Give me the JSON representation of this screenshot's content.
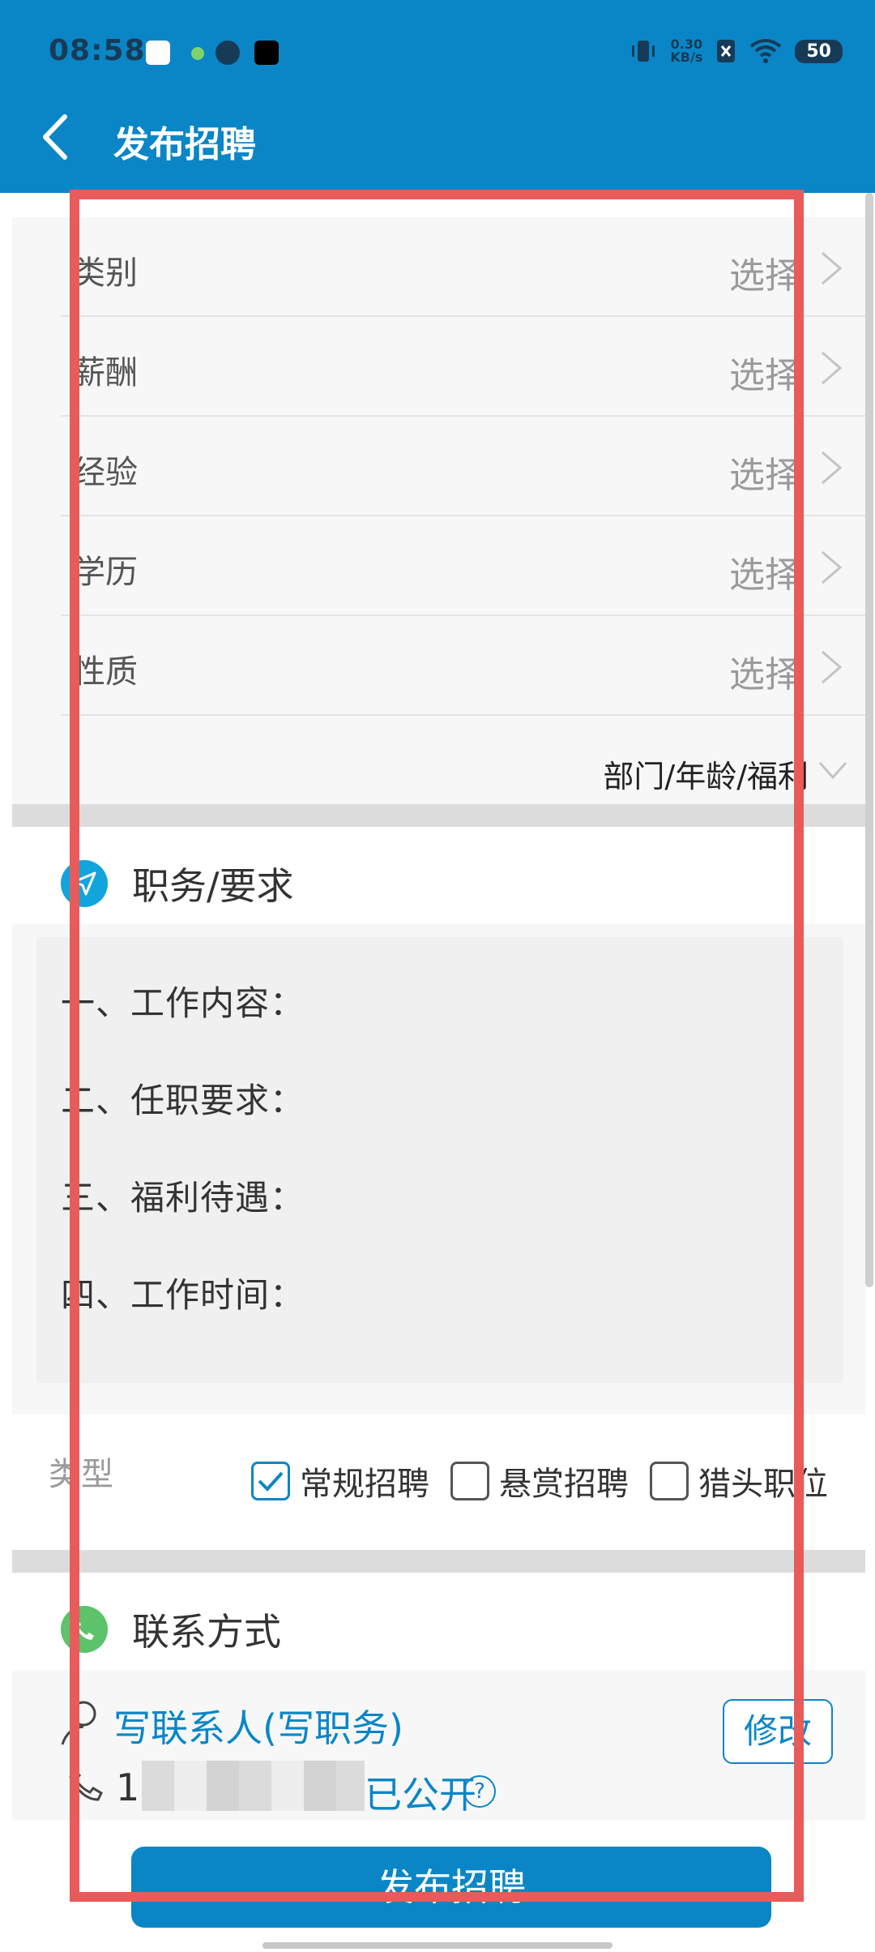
{
  "status_bar": {
    "time": "08:58",
    "net_speed_value": "0.30",
    "net_speed_unit": "KB/s",
    "battery": "50"
  },
  "header": {
    "title": "发布招聘"
  },
  "form": {
    "rows": [
      {
        "label": "类别",
        "value": "选择"
      },
      {
        "label": "薪酬",
        "value": "选择"
      },
      {
        "label": "经验",
        "value": "选择"
      },
      {
        "label": "学历",
        "value": "选择"
      },
      {
        "label": "性质",
        "value": "选择"
      }
    ],
    "more_label": "部门/年龄/福利"
  },
  "requirements": {
    "section_title": "职务/要求",
    "lines": [
      "一、工作内容：",
      "二、任职要求：",
      "三、福利待遇：",
      "四、工作时间："
    ]
  },
  "type": {
    "label": "类型",
    "options": [
      {
        "label": "常规招聘",
        "checked": true
      },
      {
        "label": "悬赏招聘",
        "checked": false
      },
      {
        "label": "猎头职位",
        "checked": false
      }
    ]
  },
  "contact": {
    "section_title": "联系方式",
    "name_placeholder": "写联系人(写职务)",
    "phone_prefix": "1",
    "public_label": "已公开",
    "help_symbol": "?",
    "edit_button": "修改"
  },
  "actions": {
    "publish": "发布招聘"
  },
  "colors": {
    "primary": "#0a86c6",
    "highlight": "#e85b5b",
    "contact_icon": "#5cc36b"
  }
}
